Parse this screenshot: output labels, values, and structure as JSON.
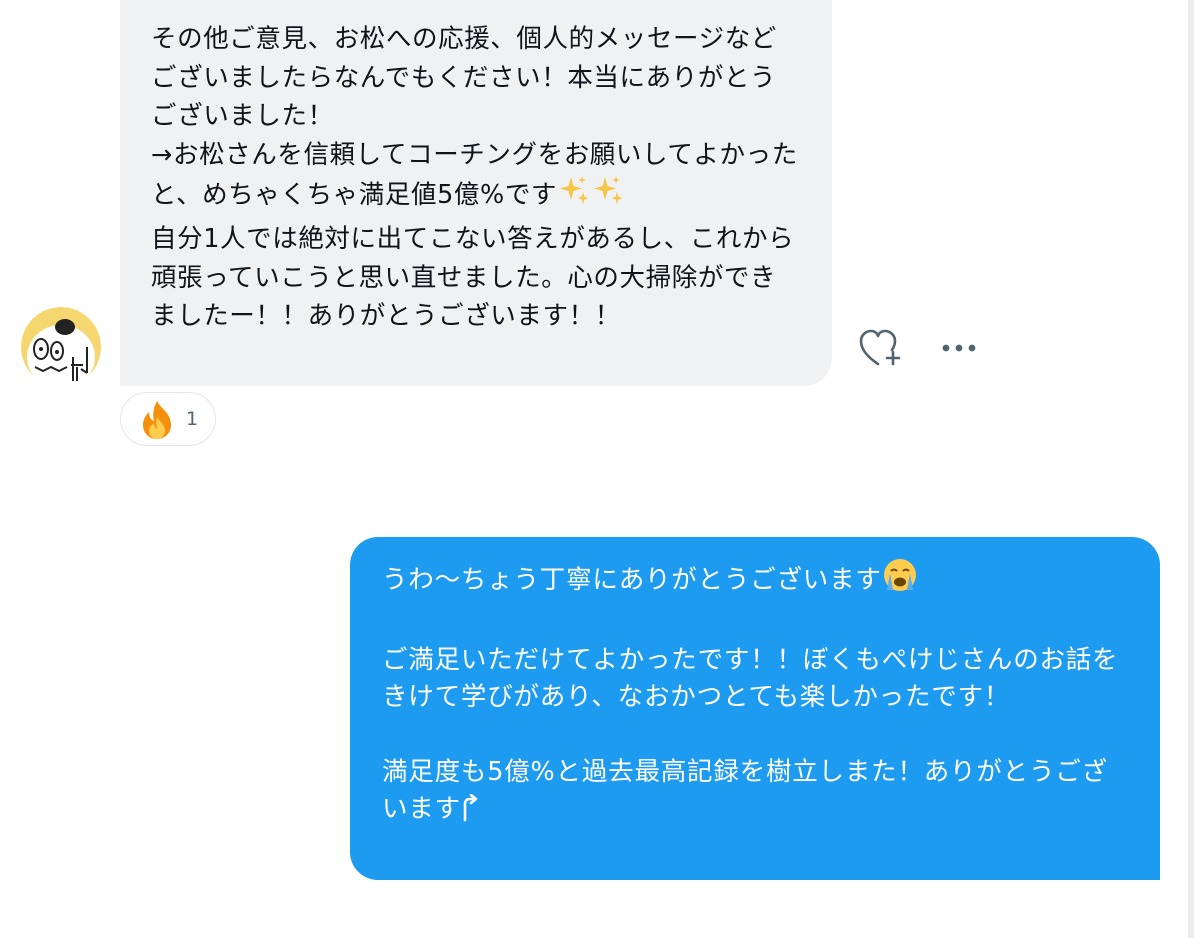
{
  "conversation": {
    "incoming": {
      "text": "その他ご意見、お松への応援、個人的メッセージなどございましたらなんでもください！本当にありがとうございました！\n→お松さんを信頼してコーチングをお願いしてよかったと、めちゃくちゃ満足値5億%です",
      "text_after_emoji": "\n自分1人では絶対に出てこない答えがあるし、これから頑張っていこうと思い直せました。心の大掃除ができましたー！！ありがとうございます！！",
      "text_emoji": "sparkles-icon x2",
      "avatar": "sender-avatar-illustration",
      "reaction": {
        "icon": "fire-icon",
        "count": "1"
      },
      "actions": {
        "react_icon": "heart-plus-icon",
        "more_icon": "more-dots-icon"
      }
    },
    "outgoing": {
      "line1": "うわ〜ちょう丁寧にありがとうございます",
      "line1_emoji": "loudly-crying-face-icon",
      "para2": "ご満足いただけてよかったです！！ぼくもぺけじさんのお話をきけて学びがあり、なおかつとても楽しかったです！",
      "para3": "満足度も5億%と過去最高記録を樹立しまた！ありがとうございます",
      "para3_emoji": "up-arrow-icon"
    },
    "colors": {
      "incoming_bubble": "#eff1f3",
      "outgoing_bubble": "#1d9bf0",
      "text": "#0f1419",
      "muted": "#536471"
    }
  }
}
